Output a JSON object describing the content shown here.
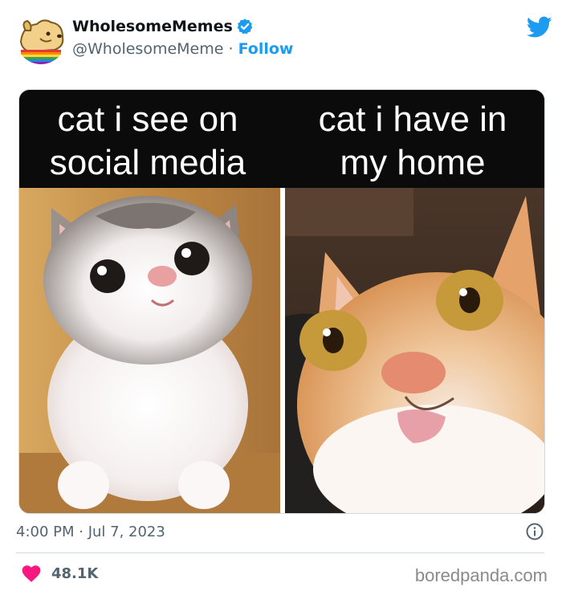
{
  "tweet": {
    "display_name": "WholesomeMemes",
    "handle": "@WholesomeMeme",
    "separator": "·",
    "follow_label": "Follow",
    "timestamp": "4:00 PM · Jul 7, 2023",
    "like_count": "48.1K"
  },
  "media": {
    "left_caption": "cat i see on\nsocial media",
    "right_caption": "cat i have in\nmy home"
  },
  "icons": {
    "verified": "verified-badge-icon",
    "twitter": "twitter-bird-icon",
    "info": "info-icon",
    "heart": "heart-icon"
  },
  "colors": {
    "accent": "#1d9bf0",
    "heart": "#f91880",
    "secondary_text": "#536471"
  },
  "watermark": "boredpanda.com"
}
